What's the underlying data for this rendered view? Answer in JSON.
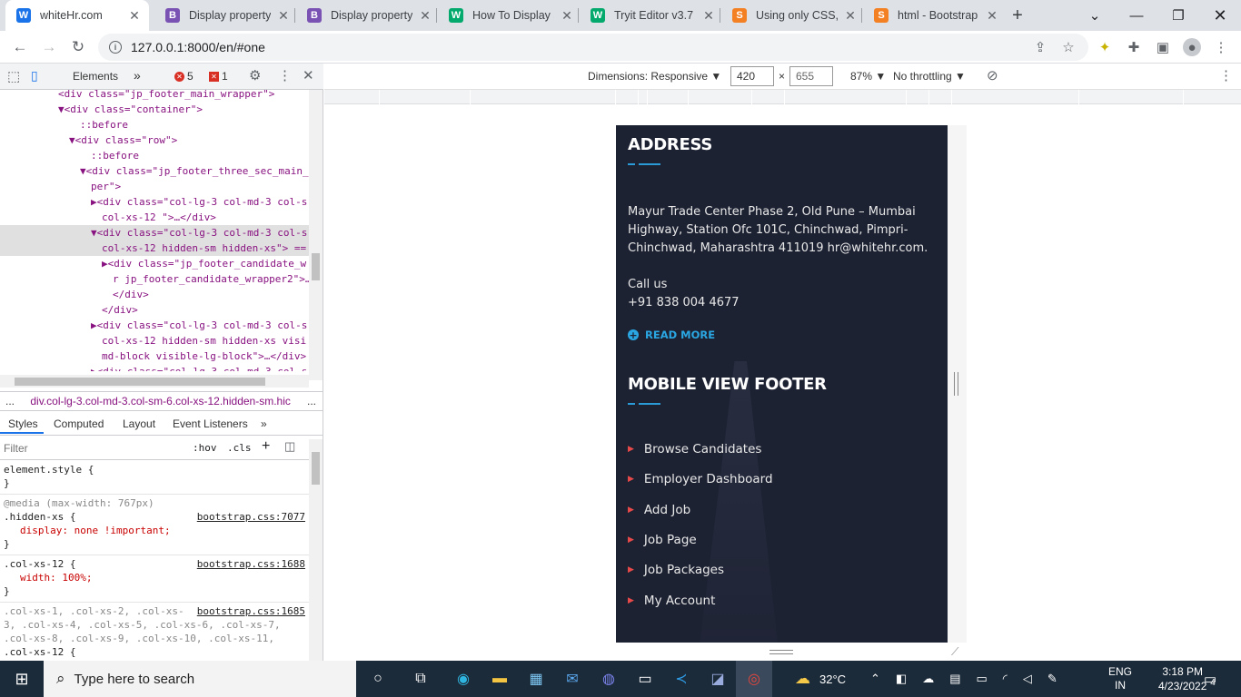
{
  "browser": {
    "tabs": [
      {
        "title": "whiteHr.com",
        "favicon": "W",
        "active": true
      },
      {
        "title": "Display property",
        "favicon": "B"
      },
      {
        "title": "Display property",
        "favicon": "B"
      },
      {
        "title": "How To Display a",
        "favicon": "W"
      },
      {
        "title": "Tryit Editor v3.7",
        "favicon": "W"
      },
      {
        "title": "Using only CSS, s",
        "favicon": "S"
      },
      {
        "title": "html - Bootstrap",
        "favicon": "S"
      }
    ],
    "new_tab": "+",
    "url": "127.0.0.1:8000/en/#one"
  },
  "devtools": {
    "tab_elements": "Elements",
    "more_tabs": "»",
    "error_count": "5",
    "issue_count": "1",
    "dom_lines": [
      {
        "indent": 5,
        "html": "<div class=\"jp_footer_main_wrapper\">"
      },
      {
        "indent": 5,
        "html": "▼<div class=\"container\">"
      },
      {
        "indent": 7,
        "html": "::before"
      },
      {
        "indent": 6,
        "html": "▼<div class=\"row\">"
      },
      {
        "indent": 8,
        "html": "::before"
      },
      {
        "indent": 7,
        "html": "▼<div class=\"jp_footer_three_sec_main_"
      },
      {
        "indent": 8,
        "html": "per\">"
      },
      {
        "indent": 8,
        "html": "▶<div class=\"col-lg-3 col-md-3 col-s"
      },
      {
        "indent": 9,
        "html": "col-xs-12 \">…</div>"
      },
      {
        "indent": 8,
        "html": "▼<div class=\"col-lg-3 col-md-3 col-s",
        "selected": true
      },
      {
        "indent": 9,
        "html": "col-xs-12 hidden-sm hidden-xs\"> ==",
        "selected": true
      },
      {
        "indent": 9,
        "html": "▶<div class=\"jp_footer_candidate_w"
      },
      {
        "indent": 10,
        "html": "r jp_footer_candidate_wrapper2\">…"
      },
      {
        "indent": 10,
        "html": "</div>"
      },
      {
        "indent": 9,
        "html": "</div>"
      },
      {
        "indent": 8,
        "html": "▶<div class=\"col-lg-3 col-md-3 col-s"
      },
      {
        "indent": 9,
        "html": "col-xs-12  hidden-sm hidden-xs visi"
      },
      {
        "indent": 9,
        "html": "md-block visible-lg-block\">…</div>"
      },
      {
        "indent": 8,
        "html": "▶<div class=\"col-lg-3 col-md-3 col-s"
      }
    ],
    "breadcrumb_dots": "...",
    "breadcrumb": "div.col-lg-3.col-md-3.col-sm-6.col-xs-12.hidden-sm.hic",
    "breadcrumb_more": "...",
    "style_tabs": [
      "Styles",
      "Computed",
      "Layout",
      "Event Listeners",
      "»"
    ],
    "filter_placeholder": "Filter",
    "hov": ":hov",
    "cls": ".cls",
    "rules": [
      {
        "lines": [
          "element.style {",
          "}"
        ]
      },
      {
        "media": "@media (max-width: 767px)",
        "selector": ".hidden-xs {",
        "source": "bootstrap.css:7077",
        "props": [
          "display: none !important;"
        ],
        "close": "}"
      },
      {
        "selector": ".col-xs-12 {",
        "source": "bootstrap.css:1688",
        "props": [
          "width: 100%;"
        ],
        "close": "}"
      },
      {
        "selector_muted": ".col-xs-1, .col-xs-2, .col-xs-",
        "source": "bootstrap.css:1685",
        "more": [
          "3, .col-xs-4, .col-xs-5, .col-xs-6, .col-xs-7,",
          ".col-xs-8, .col-xs-9, .col-xs-10, .col-xs-11,"
        ],
        "selector": ".col-xs-12 {",
        "props": [
          "float: left;"
        ]
      }
    ]
  },
  "device_toolbar": {
    "dimensions": "Dimensions: Responsive ▼",
    "width": "420",
    "x": "×",
    "height": "655",
    "zoom": "87% ▼",
    "throttling": "No throttling ▼"
  },
  "page": {
    "address_title": "ADDRESS",
    "address_text": "Mayur Trade Center Phase 2, Old Pune – Mumbai Highway, Station Ofc 101C, Chinchwad, Pimpri-Chinchwad, Maharashtra 411019 hr@whitehr.com.",
    "call_label": "Call us",
    "phone": "+91 838 004 4677",
    "read_more": "READ MORE",
    "mobile_title": "MOBILE VIEW FOOTER",
    "links": [
      "Browse Candidates",
      "Employer Dashboard",
      "Add Job",
      "Job Page",
      "Job Packages",
      "My Account"
    ]
  },
  "taskbar": {
    "search_placeholder": "Type here to search",
    "weather": "32°C",
    "lang1": "ENG",
    "lang2": "IN",
    "time": "3:18 PM",
    "date": "4/23/2022",
    "notifications": "4"
  }
}
